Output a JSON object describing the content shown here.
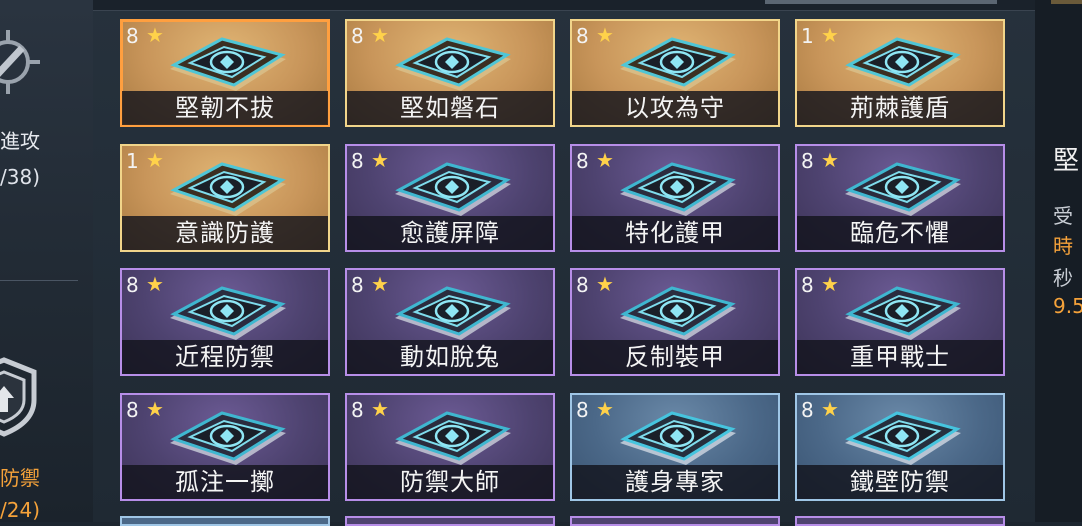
{
  "left_panel": {
    "attack_label": "進攻",
    "attack_count": "/38)",
    "defense_label": "防禦",
    "defense_count": "/24)"
  },
  "right_panel": {
    "title": "堅",
    "line1": "受",
    "line2": "時",
    "line3": "秒",
    "line4": "9.5"
  },
  "colors": {
    "gold": "#c8955a",
    "purple": "#4e4370",
    "blue": "#4b6888",
    "selected_border": "#ff9f3f",
    "star": "#ffd24a"
  },
  "cards": [
    {
      "name": "堅韌不拔",
      "level": "8",
      "rarity": "gold",
      "icon": "head-guard-icon",
      "selected": true
    },
    {
      "name": "堅如磐石",
      "level": "8",
      "rarity": "gold",
      "icon": "rock-sword-icon"
    },
    {
      "name": "以攻為守",
      "level": "8",
      "rarity": "gold",
      "icon": "attack-defense-icon"
    },
    {
      "name": "荊棘護盾",
      "level": "1",
      "rarity": "gold",
      "icon": "thorn-shield-icon"
    },
    {
      "name": "意識防護",
      "level": "1",
      "rarity": "gold",
      "icon": "mind-shield-icon"
    },
    {
      "name": "愈護屏障",
      "level": "8",
      "rarity": "purple",
      "icon": "heal-barrier-icon"
    },
    {
      "name": "特化護甲",
      "level": "8",
      "rarity": "purple",
      "icon": "special-armor-icon"
    },
    {
      "name": "臨危不懼",
      "level": "8",
      "rarity": "purple",
      "icon": "fearless-icon"
    },
    {
      "name": "近程防禦",
      "level": "8",
      "rarity": "purple",
      "icon": "melee-defense-icon"
    },
    {
      "name": "動如脫兔",
      "level": "8",
      "rarity": "purple",
      "icon": "swift-icon"
    },
    {
      "name": "反制裝甲",
      "level": "8",
      "rarity": "purple",
      "icon": "counter-armor-icon"
    },
    {
      "name": "重甲戰士",
      "level": "8",
      "rarity": "purple",
      "icon": "heavy-armor-icon"
    },
    {
      "name": "孤注一擲",
      "level": "8",
      "rarity": "purple",
      "icon": "all-in-icon"
    },
    {
      "name": "防禦大師",
      "level": "8",
      "rarity": "purple",
      "icon": "defense-master-icon"
    },
    {
      "name": "護身專家",
      "level": "8",
      "rarity": "blue",
      "icon": "heart-guard-icon"
    },
    {
      "name": "鐵壁防禦",
      "level": "8",
      "rarity": "blue",
      "icon": "iron-wall-icon"
    }
  ]
}
